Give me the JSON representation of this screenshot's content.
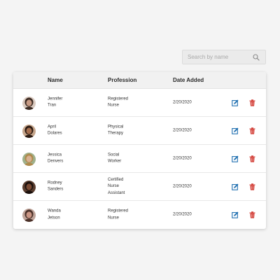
{
  "search": {
    "placeholder": "Search by name",
    "icon": "search-icon"
  },
  "table": {
    "columns": [
      "Name",
      "Profession",
      "Date Added"
    ],
    "rows": [
      {
        "name": [
          "Jennifer",
          "Tran"
        ],
        "profession": [
          "Registered",
          "Nurse"
        ],
        "date": "2/20/2020",
        "avatar": {
          "skin": "#c79a84",
          "hair": "#3b2a22",
          "bg": "#d9c9bf"
        }
      },
      {
        "name": [
          "April",
          "Dolares"
        ],
        "profession": [
          "Physical",
          "Therapy"
        ],
        "date": "2/20/2020",
        "avatar": {
          "skin": "#a66f4f",
          "hair": "#2a1a12",
          "bg": "#c5a58b"
        }
      },
      {
        "name": [
          "Jessica",
          "Denvers"
        ],
        "profession": [
          "Social",
          "Worker"
        ],
        "date": "2/20/2020",
        "avatar": {
          "skin": "#d8b193",
          "hair": "#b08a4c",
          "bg": "#9fb08b"
        }
      },
      {
        "name": [
          "Rodney",
          "Sanders"
        ],
        "profession": [
          "Certified",
          "Nurse",
          "Assistant"
        ],
        "date": "2/20/2020",
        "avatar": {
          "skin": "#7a4a33",
          "hair": "#1a100c",
          "bg": "#5a3d2e"
        }
      },
      {
        "name": [
          "Wanda",
          "Jetson"
        ],
        "profession": [
          "Registered",
          "Nurse"
        ],
        "date": "2/20/2020",
        "avatar": {
          "skin": "#c99584",
          "hair": "#4a3028",
          "bg": "#bfa49a"
        }
      }
    ],
    "actions": {
      "edit_icon": "edit-icon",
      "delete_icon": "trash-icon"
    }
  },
  "colors": {
    "edit": "#1f6fb0",
    "delete": "#d0342c"
  }
}
